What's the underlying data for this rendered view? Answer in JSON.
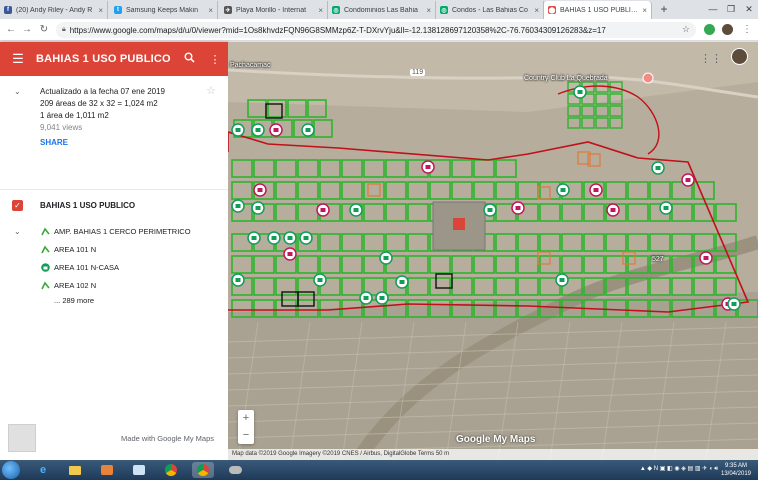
{
  "browser": {
    "tabs": [
      {
        "label": "(20) Andy Riley - Andy R",
        "color": "#3b5998",
        "glyph": "f",
        "active": false
      },
      {
        "label": "Samsung Keeps Makin",
        "color": "#1da1f2",
        "glyph": "t",
        "active": false
      },
      {
        "label": "Playa Morillo - Internat",
        "color": "#555555",
        "glyph": "✈",
        "active": false
      },
      {
        "label": "Condominios Las Bahia",
        "color": "#00aa6c",
        "glyph": "◎",
        "active": false
      },
      {
        "label": "Condos - Las Bahias Co",
        "color": "#00aa6c",
        "glyph": "◎",
        "active": false
      },
      {
        "label": "BAHIAS 1 USO PUBLICO",
        "color": "#db4437",
        "glyph": "⬤",
        "active": true
      }
    ],
    "url": "https://www.google.com/maps/d/u/0/viewer?mid=1Os8khvdzFQN96G8SMMzp6Z-T-DXrvYju&ll=-12.138128697120358%2C-76.76034309126283&z=17"
  },
  "panel": {
    "title": "BAHIAS 1 USO PUBLICO",
    "info_lines": [
      "Actualizado a la fecha 07 ene 2019",
      "209 áreas de 32 x 32 = 1,024 m2",
      "1 área de 1,011 m2"
    ],
    "views": "9,041 views",
    "share": "SHARE",
    "layer_name": "BAHIAS 1 USO PUBLICO",
    "items": [
      {
        "label": "AMP. BAHIAS 1 CERCO PERIMETRICO",
        "icon": "line-icon"
      },
      {
        "label": "AREA 101 N",
        "icon": "line-icon"
      },
      {
        "label": "AREA 101 N-CASA",
        "icon": "house-pin-icon"
      },
      {
        "label": "AREA 102 N",
        "icon": "line-icon"
      }
    ],
    "more": "... 289 more",
    "footer": "Made with Google My Maps"
  },
  "map": {
    "road_label": "Pachacamac",
    "route_label": "119",
    "club_label": "Country Club La Quebrada",
    "lot_label": "527",
    "brand_google": "Google",
    "brand_mymaps": " My Maps",
    "attribution": "Map data ©2019 Google Imagery ©2019 CNES / Airbus, DigitalGlobe   Terms   50 m",
    "zoom_in": "+",
    "zoom_out": "−"
  },
  "taskbar": {
    "time": "9:35 AM",
    "date": "13/04/2019"
  },
  "colors": {
    "accent": "#db4437",
    "lot_green": "#2db52d",
    "boundary": "#c0101a",
    "pin_pink": "#c2185b",
    "pin_green": "#0f9d58"
  }
}
